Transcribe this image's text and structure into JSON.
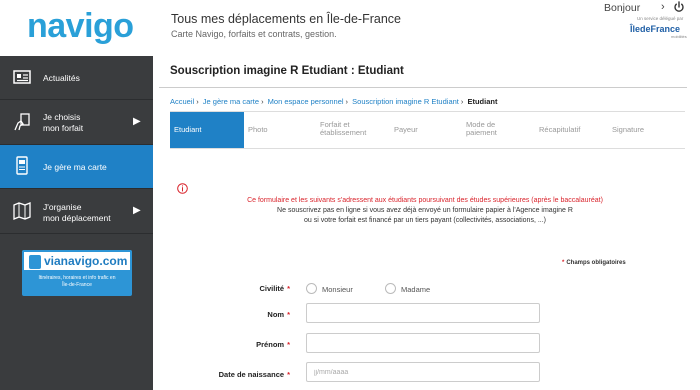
{
  "header": {
    "logo": "navigo",
    "tagline": "Tous mes déplacements en Île-de-France",
    "subtagline": "Carte Navigo, forfaits et contrats, gestion.",
    "greeting": "Bonjour",
    "partner": {
      "small": "Un service délégué par",
      "main": "ÎledeFrance",
      "sub": "mobilités"
    }
  },
  "sidebar": {
    "items": [
      {
        "label": "Actualités",
        "icon": "news-icon"
      },
      {
        "label": "Je choisis\nmon forfait",
        "icon": "hand-ticket-icon"
      },
      {
        "label": "Je gère ma carte",
        "icon": "card-icon"
      },
      {
        "label": "J'organise\nmon déplacement",
        "icon": "map-icon"
      }
    ],
    "promo": {
      "title": "vianavigo.com",
      "desc": "Itinéraires, horaires et info trafic en\nÎle-de-France"
    }
  },
  "main": {
    "title": "Souscription imagine R Etudiant : Etudiant",
    "breadcrumb": [
      "Accueil",
      "Je gère ma carte",
      "Mon espace personnel",
      "Souscription imagine R Etudiant",
      "Etudiant"
    ],
    "steps": [
      "Etudiant",
      "Photo",
      "Forfait et\nétablissement",
      "Payeur",
      "Mode de\npaiement",
      "Récapitulatif",
      "Signature"
    ],
    "notice": {
      "line1": "Ce formulaire et les suivants s'adressent aux étudiants poursuivant des études supérieures (après le baccalauréat)",
      "line2": "Ne souscrivez pas en ligne si vous avez déjà envoyé un formulaire papier à l'Agence imagine R",
      "line3": "ou si votre forfait est financé par un tiers payant  (collectivités, associations, ...)"
    },
    "required_note": "Champs obligatoires",
    "form": {
      "civility_label": "Civilité",
      "civility_options": [
        "Monsieur",
        "Madame"
      ],
      "nom_label": "Nom",
      "prenom_label": "Prénom",
      "dob_label": "Date de naissance",
      "dob_placeholder": "jj/mm/aaaa"
    }
  }
}
